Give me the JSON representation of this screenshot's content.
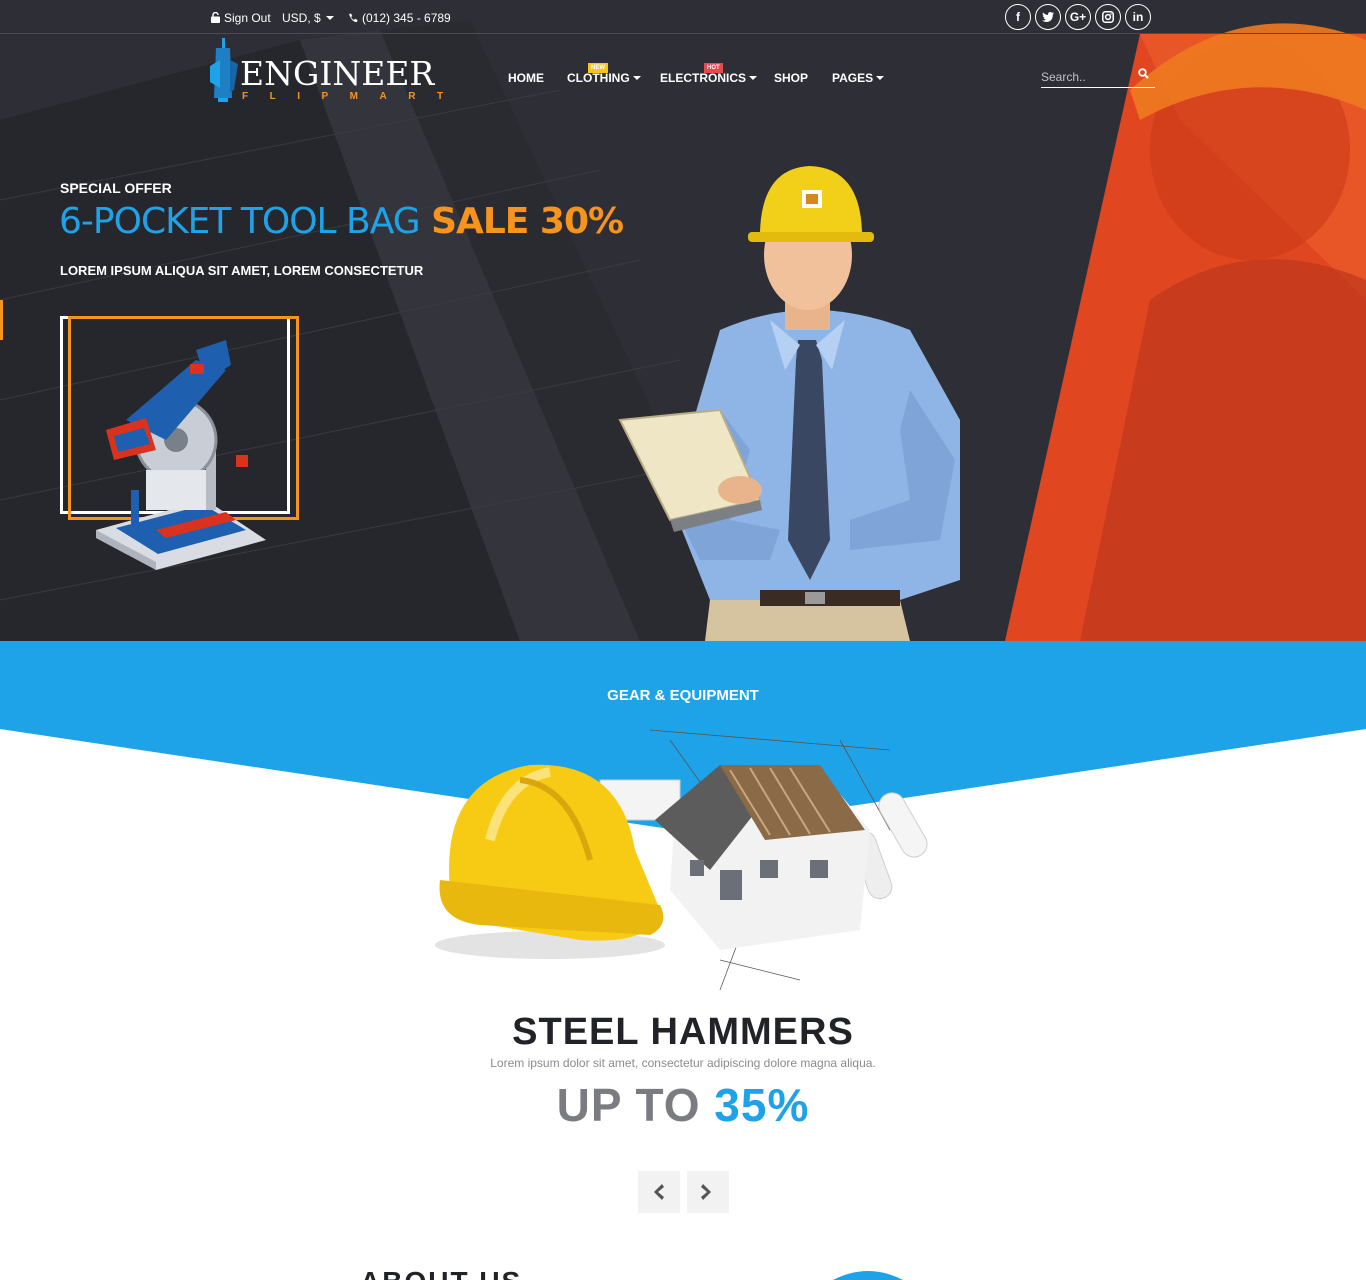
{
  "topbar": {
    "sign_out": "Sign Out",
    "currency": "USD, $",
    "phone": "(012) 345 - 6789",
    "social": [
      {
        "icon": "facebook-icon",
        "glyph": "f"
      },
      {
        "icon": "twitter-icon",
        "glyph": "t"
      },
      {
        "icon": "google-plus-icon",
        "glyph": "G+"
      },
      {
        "icon": "instagram-icon",
        "glyph": "ig"
      },
      {
        "icon": "linkedin-icon",
        "glyph": "in"
      }
    ]
  },
  "logo": {
    "word": "ENGINEER",
    "sub": "FLIPMART"
  },
  "nav": {
    "items": [
      "HOME",
      "CLOTHING",
      "ELECTRONICS",
      "SHOP",
      "PAGES"
    ],
    "badge_new": "NEW",
    "badge_hot": "HOT"
  },
  "search": {
    "placeholder": "Search.."
  },
  "hero": {
    "kicker": "SPECIAL OFFER",
    "headline_blue": "6-POCKET TOOL BAG",
    "headline_orange": "SALE 30%",
    "subtitle": "LOREM IPSUM ALIQUA SIT AMET, LOREM CONSECTETUR"
  },
  "gear": {
    "title": "GEAR & EQUIPMENT",
    "product_title": "STEEL HAMMERS",
    "text": "Lorem ipsum dolor sit amet, consectetur adipiscing dolore magna aliqua.",
    "upto": "UP TO",
    "percent": "35%"
  },
  "about": {
    "title": "ABOUT US"
  },
  "colors": {
    "dark": "#2e2f36",
    "orange": "#f7941d",
    "blue": "#1ea3e8",
    "red": "#e0461f"
  }
}
